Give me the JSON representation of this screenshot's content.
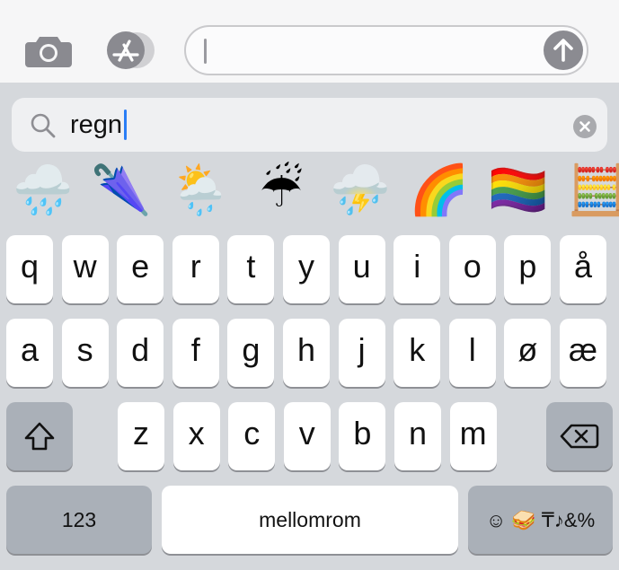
{
  "compose": {
    "camera_icon": "camera-icon",
    "appstore_icon": "app-store-icon",
    "message_value": "",
    "send_icon": "arrow-up-icon"
  },
  "emoji_search": {
    "query": "regn",
    "results": [
      {
        "glyph": "🌧️",
        "name": "cloud-with-rain"
      },
      {
        "glyph": "🌂",
        "name": "closed-umbrella"
      },
      {
        "glyph": "🌦️",
        "name": "sun-behind-rain-cloud"
      },
      {
        "glyph": "☔",
        "name": "umbrella-with-rain-drops"
      },
      {
        "glyph": "⛈️",
        "name": "cloud-with-lightning-and-rain"
      },
      {
        "glyph": "🌈",
        "name": "rainbow"
      },
      {
        "glyph": "🏳️‍🌈",
        "name": "rainbow-flag"
      },
      {
        "glyph": "🧮",
        "name": "abacus"
      }
    ]
  },
  "keyboard": {
    "row1": [
      "q",
      "w",
      "e",
      "r",
      "t",
      "y",
      "u",
      "i",
      "o",
      "p",
      "å"
    ],
    "row2": [
      "a",
      "s",
      "d",
      "f",
      "g",
      "h",
      "j",
      "k",
      "l",
      "ø",
      "æ"
    ],
    "row3": [
      "z",
      "x",
      "c",
      "v",
      "b",
      "n",
      "m"
    ],
    "numbers_label": "123",
    "space_label": "mellomrom",
    "emoji_key_symbols": "☺ 🥪 ₸♪&%"
  }
}
